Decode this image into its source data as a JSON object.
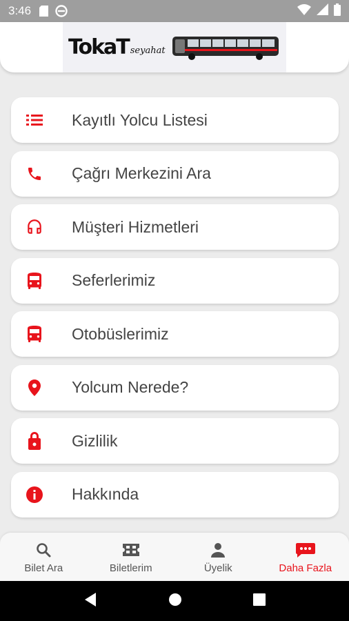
{
  "status_bar": {
    "time": "3:46",
    "icons": [
      "sd-card-icon",
      "do-not-disturb-icon",
      "wifi-icon",
      "signal-icon",
      "battery-icon"
    ]
  },
  "header": {
    "logo_brand": "TokaT",
    "logo_sub": "seyahat"
  },
  "colors": {
    "accent": "#e8141c",
    "background": "#ececec",
    "card": "#ffffff",
    "text": "#444444"
  },
  "menu": {
    "items": [
      {
        "label": "Kayıtlı Yolcu Listesi",
        "icon": "list-icon"
      },
      {
        "label": "Çağrı Merkezini Ara",
        "icon": "phone-icon"
      },
      {
        "label": "Müşteri Hizmetleri",
        "icon": "headset-icon"
      },
      {
        "label": "Seferlerimiz",
        "icon": "bus-icon"
      },
      {
        "label": "Otobüslerimiz",
        "icon": "bus-icon"
      },
      {
        "label": "Yolcum Nerede?",
        "icon": "location-pin-icon"
      },
      {
        "label": "Gizlilik",
        "icon": "lock-icon"
      },
      {
        "label": "Hakkında",
        "icon": "info-icon"
      }
    ]
  },
  "bottom_nav": {
    "items": [
      {
        "label": "Bilet Ara",
        "icon": "search-icon",
        "active": false
      },
      {
        "label": "Biletlerim",
        "icon": "ticket-icon",
        "active": false
      },
      {
        "label": "Üyelik",
        "icon": "person-icon",
        "active": false
      },
      {
        "label": "Daha Fazla",
        "icon": "more-chat-icon",
        "active": true
      }
    ]
  }
}
